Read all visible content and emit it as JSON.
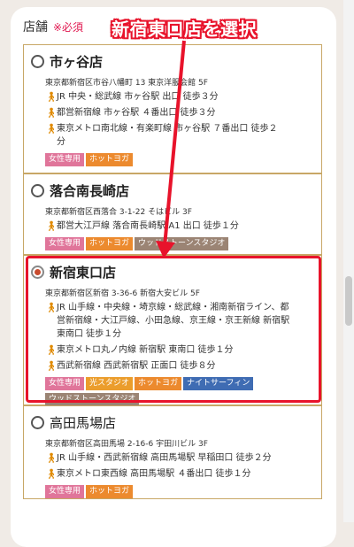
{
  "header": {
    "label": "店舗",
    "required": "※必須"
  },
  "annotation": {
    "banner": "新宿東口店を選択"
  },
  "colors": {
    "accent_red": "#e8132b",
    "women": "#e0759a",
    "hot_yoga": "#ec8a2e",
    "light_studio": "#eb9d2c",
    "night_surfing": "#3f6cb3",
    "wood_stone": "#9b8474",
    "walk_icon": "#e08a00"
  },
  "stores": [
    {
      "name": "市ヶ谷店",
      "address": "東京都新宿区市谷八幡町 13 東京洋服会館 5F",
      "access": [
        "JR 中央・総武線 市ヶ谷駅 出口 徒歩３分",
        "都営新宿線 市ヶ谷駅 ４番出口 徒歩３分",
        "東京メトロ南北線・有楽町線 市ヶ谷駅 ７番出口 徒歩２分"
      ],
      "tags": [
        {
          "label": "女性専用",
          "color": "women"
        },
        {
          "label": "ホットヨガ",
          "color": "hot_yoga"
        }
      ]
    },
    {
      "name": "落合南長崎店",
      "address": "東京都新宿区西落合 3-1-22 そはビル 3F",
      "access": [
        "都営大江戸線 落合南長崎駅 A1 出口 徒歩１分"
      ],
      "tags": [
        {
          "label": "女性専用",
          "color": "women"
        },
        {
          "label": "ホットヨガ",
          "color": "hot_yoga"
        },
        {
          "label": "ウッドストーンスタジオ",
          "color": "wood_stone"
        }
      ]
    },
    {
      "name": "新宿東口店",
      "address": "東京都新宿区新宿 3-36-6 新宿大安ビル 5F",
      "access": [
        "JR 山手線・中央線・埼京線・総武線・湘南新宿ライン、都営新宿線・大江戸線、小田急線、京王線・京王新線 新宿駅 東南口 徒歩１分",
        "東京メトロ丸ノ内線 新宿駅 東南口 徒歩１分",
        "西武新宿線 西武新宿駅 正面口 徒歩８分"
      ],
      "tags": [
        {
          "label": "女性専用",
          "color": "women"
        },
        {
          "label": "光スタジオ",
          "color": "light_studio"
        },
        {
          "label": "ホットヨガ",
          "color": "hot_yoga"
        },
        {
          "label": "ナイトサーフィン",
          "color": "night_surfing"
        },
        {
          "label": "ウッドストーンスタジオ",
          "color": "wood_stone"
        }
      ]
    },
    {
      "name": "高田馬場店",
      "address": "東京都新宿区高田馬場 2-16-6 宇田川ビル 3F",
      "access": [
        "JR 山手線・西武新宿線 高田馬場駅 早稲田口 徒歩２分",
        "東京メトロ東西線 高田馬場駅 ４番出口 徒歩１分"
      ],
      "tags": [
        {
          "label": "女性専用",
          "color": "women"
        },
        {
          "label": "ホットヨガ",
          "color": "hot_yoga"
        }
      ]
    }
  ]
}
